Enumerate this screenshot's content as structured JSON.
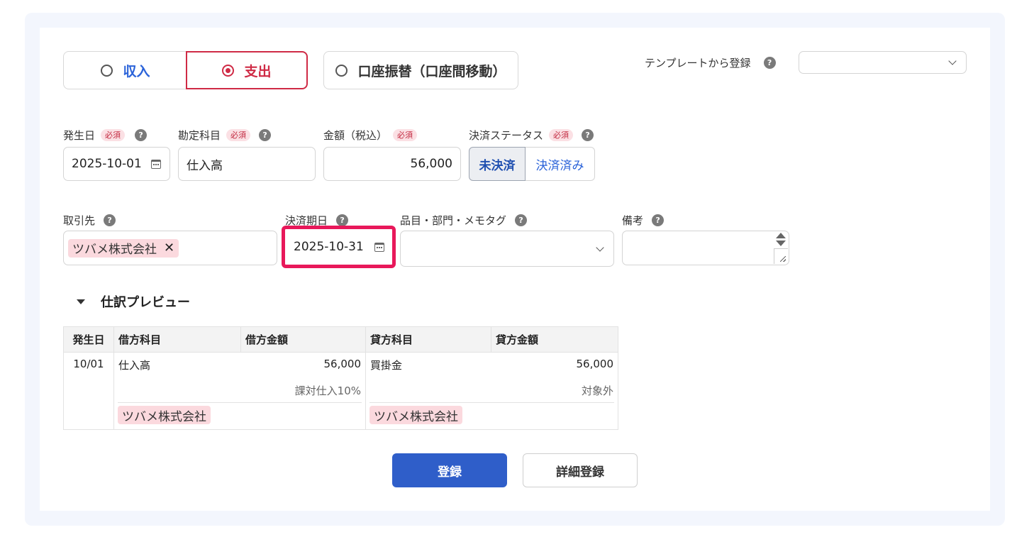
{
  "type_tabs": {
    "income": "収入",
    "expense": "支出",
    "transfer": "口座振替（口座間移動）"
  },
  "template": {
    "label": "テンプレートから登録",
    "value": ""
  },
  "fields": {
    "required_badge": "必須",
    "date_label": "発生日",
    "date_value": "2025-10-01",
    "account_label": "勘定科目",
    "account_value": "仕入高",
    "amount_label": "金額（税込）",
    "amount_value": "56,000",
    "status_label": "決済ステータス",
    "status_unpaid": "未決済",
    "status_paid": "決済済み",
    "partner_label": "取引先",
    "partner_tag": "ツバメ株式会社",
    "due_label": "決済期日",
    "due_value": "2025-10-31",
    "item_label": "品目・部門・メモタグ",
    "memo_label": "備考"
  },
  "preview": {
    "title": "仕訳プレビュー",
    "columns": [
      "発生日",
      "借方科目",
      "借方金額",
      "貸方科目",
      "貸方金額"
    ],
    "row": {
      "date": "10/01",
      "debit_account": "仕入高",
      "debit_amount": "56,000",
      "debit_tax": "課対仕入10%",
      "debit_partner": "ツバメ株式会社",
      "credit_account": "買掛金",
      "credit_amount": "56,000",
      "credit_tax": "対象外",
      "credit_partner": "ツバメ株式会社"
    }
  },
  "buttons": {
    "register": "登録",
    "detail_register": "詳細登録"
  },
  "colors": {
    "primary": "#2f5ec9",
    "expense_accent": "#cf2a45",
    "highlight": "#e8185a",
    "tag_bg": "#fbd9de"
  }
}
